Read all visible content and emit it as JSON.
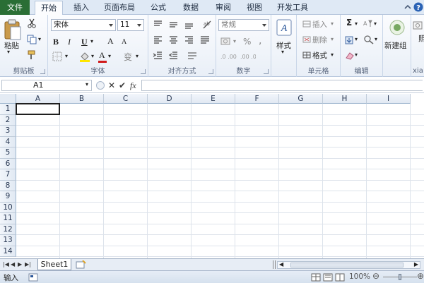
{
  "ribbon_tabs": {
    "file": "文件",
    "home": "开始",
    "insert": "插入",
    "page_layout": "页面布局",
    "formulas": "公式",
    "data": "数据",
    "review": "审阅",
    "view": "视图",
    "developer": "开发工具"
  },
  "clipboard": {
    "paste": "粘贴",
    "group_label": "剪贴板"
  },
  "font": {
    "name": "宋体",
    "size": "11",
    "bold": "B",
    "italic": "I",
    "underline": "U",
    "grow": "A",
    "shrink": "A",
    "font_color_letter": "A",
    "phonetic": "变",
    "group_label": "字体"
  },
  "alignment": {
    "group_label": "对齐方式"
  },
  "number": {
    "format": "常规",
    "percent": "%",
    "comma": ",",
    "group_label": "数字"
  },
  "styles": {
    "label": "样式"
  },
  "cells": {
    "insert": "插入",
    "delete": "删除",
    "format": "格式",
    "group_label": "单元格"
  },
  "editing": {
    "sigma": "Σ",
    "group_label": "编辑"
  },
  "new_group": {
    "label": "新建组",
    "photo_label": "照",
    "partial_label": "xia"
  },
  "formula_bar": {
    "cell_ref": "A1",
    "cancel": "✕",
    "confirm": "✔",
    "fx": "fx",
    "value": ""
  },
  "columns": [
    "A",
    "B",
    "C",
    "D",
    "E",
    "F",
    "G",
    "H",
    "I"
  ],
  "rows": [
    "1",
    "2",
    "3",
    "4",
    "5",
    "6",
    "7",
    "8",
    "9",
    "10",
    "11",
    "12",
    "13",
    "14"
  ],
  "sheet_tabs": {
    "sheet1": "Sheet1"
  },
  "status_bar": {
    "mode": "输入",
    "zoom": "100%"
  },
  "colors": {
    "file_tab": "#2a6e35",
    "font_color_bar": "#d01a1a",
    "accent": "#2b579a"
  }
}
